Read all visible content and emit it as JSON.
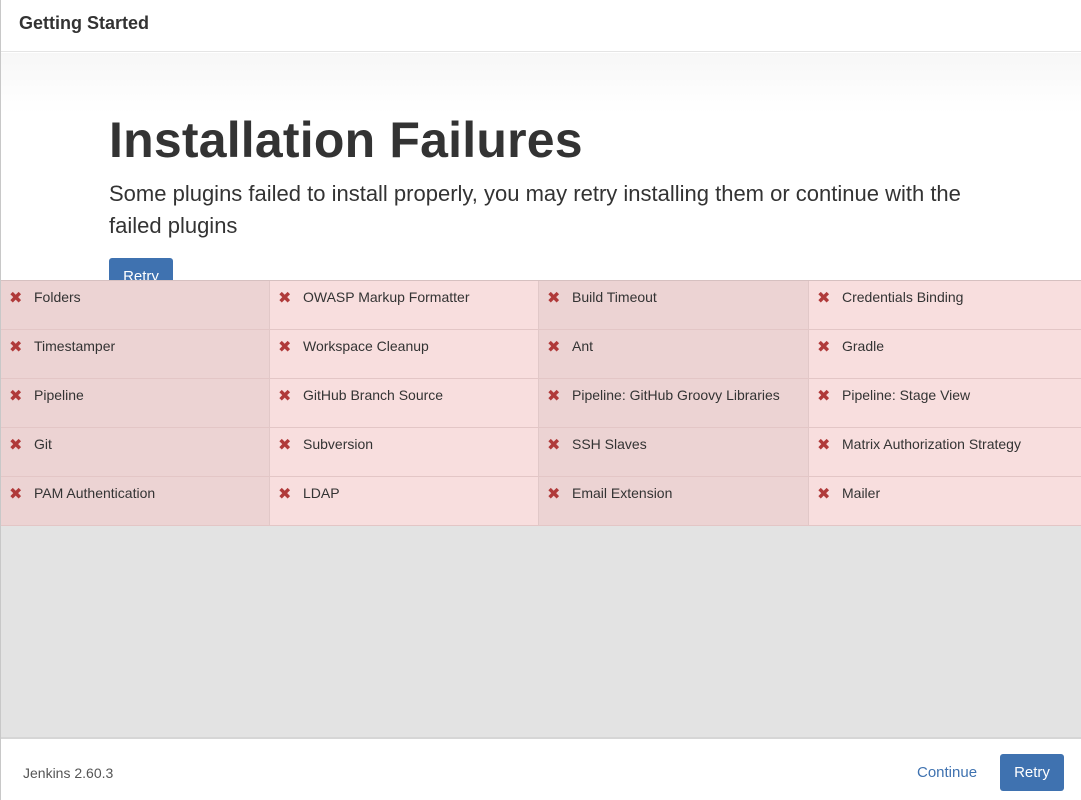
{
  "header": {
    "title": "Getting Started"
  },
  "hero": {
    "title": "Installation Failures",
    "subtitle": "Some plugins failed to install properly, you may retry installing them or continue with the failed plugins",
    "retry_label": "Retry"
  },
  "plugins": [
    {
      "name": "Folders",
      "status": "failed"
    },
    {
      "name": "OWASP Markup Formatter",
      "status": "failed"
    },
    {
      "name": "Build Timeout",
      "status": "failed"
    },
    {
      "name": "Credentials Binding",
      "status": "failed"
    },
    {
      "name": "Timestamper",
      "status": "failed"
    },
    {
      "name": "Workspace Cleanup",
      "status": "failed"
    },
    {
      "name": "Ant",
      "status": "failed"
    },
    {
      "name": "Gradle",
      "status": "failed"
    },
    {
      "name": "Pipeline",
      "status": "failed"
    },
    {
      "name": "GitHub Branch Source",
      "status": "failed"
    },
    {
      "name": "Pipeline: GitHub Groovy Libraries",
      "status": "failed"
    },
    {
      "name": "Pipeline: Stage View",
      "status": "failed"
    },
    {
      "name": "Git",
      "status": "failed"
    },
    {
      "name": "Subversion",
      "status": "failed"
    },
    {
      "name": "SSH Slaves",
      "status": "failed"
    },
    {
      "name": "Matrix Authorization Strategy",
      "status": "failed"
    },
    {
      "name": "PAM Authentication",
      "status": "failed"
    },
    {
      "name": "LDAP",
      "status": "failed"
    },
    {
      "name": "Email Extension",
      "status": "failed"
    },
    {
      "name": "Mailer",
      "status": "failed"
    }
  ],
  "icons": {
    "failed": "close-x-icon"
  },
  "colors": {
    "accent": "#3f72b0",
    "failed_bg": "#f8dede",
    "failed_icon": "#b03a3a"
  },
  "footer": {
    "version": "Jenkins 2.60.3",
    "continue_label": "Continue",
    "retry_label": "Retry"
  }
}
